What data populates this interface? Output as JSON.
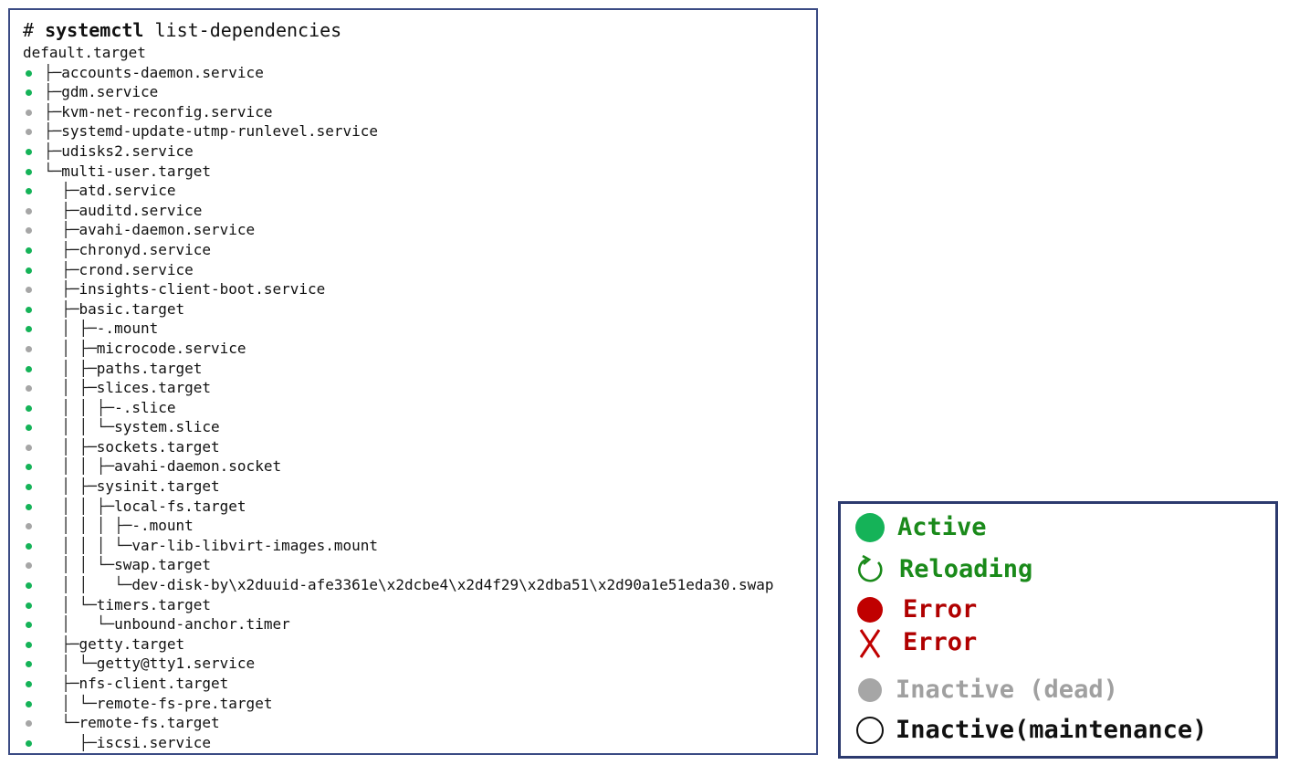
{
  "command": {
    "prompt": "#",
    "program": "systemctl",
    "args": "list-dependencies"
  },
  "root": "default.target",
  "rows": [
    {
      "status": "active",
      "prefix": "├─",
      "depth": 0,
      "name": "accounts-daemon.service"
    },
    {
      "status": "active",
      "prefix": "├─",
      "depth": 0,
      "name": "gdm.service"
    },
    {
      "status": "inactive",
      "prefix": "├─",
      "depth": 0,
      "name": "kvm-net-reconfig.service"
    },
    {
      "status": "inactive",
      "prefix": "├─",
      "depth": 0,
      "name": "systemd-update-utmp-runlevel.service"
    },
    {
      "status": "active",
      "prefix": "├─",
      "depth": 0,
      "name": "udisks2.service"
    },
    {
      "status": "active",
      "prefix": "└─",
      "depth": 0,
      "name": "multi-user.target"
    },
    {
      "status": "active",
      "prefix": "  ├─",
      "depth": 1,
      "name": "atd.service"
    },
    {
      "status": "inactive",
      "prefix": "  ├─",
      "depth": 1,
      "name": "auditd.service"
    },
    {
      "status": "inactive",
      "prefix": "  ├─",
      "depth": 1,
      "name": "avahi-daemon.service"
    },
    {
      "status": "active",
      "prefix": "  ├─",
      "depth": 1,
      "name": "chronyd.service"
    },
    {
      "status": "active",
      "prefix": "  ├─",
      "depth": 1,
      "name": "crond.service"
    },
    {
      "status": "inactive",
      "prefix": "  ├─",
      "depth": 1,
      "name": "insights-client-boot.service"
    },
    {
      "status": "active",
      "prefix": "  ├─",
      "depth": 1,
      "name": "basic.target"
    },
    {
      "status": "active",
      "prefix": "  │ ├─",
      "depth": 2,
      "name": "-.mount"
    },
    {
      "status": "inactive",
      "prefix": "  │ ├─",
      "depth": 2,
      "name": "microcode.service"
    },
    {
      "status": "active",
      "prefix": "  │ ├─",
      "depth": 2,
      "name": "paths.target"
    },
    {
      "status": "inactive",
      "prefix": "  │ ├─",
      "depth": 2,
      "name": "slices.target"
    },
    {
      "status": "active",
      "prefix": "  │ │ ├─",
      "depth": 3,
      "name": "-.slice"
    },
    {
      "status": "active",
      "prefix": "  │ │ └─",
      "depth": 3,
      "name": "system.slice"
    },
    {
      "status": "inactive",
      "prefix": "  │ ├─",
      "depth": 2,
      "name": "sockets.target"
    },
    {
      "status": "active",
      "prefix": "  │ │ ├─",
      "depth": 3,
      "name": "avahi-daemon.socket"
    },
    {
      "status": "active",
      "prefix": "  │ ├─",
      "depth": 2,
      "name": "sysinit.target"
    },
    {
      "status": "active",
      "prefix": "  │ │ ├─",
      "depth": 3,
      "name": "local-fs.target"
    },
    {
      "status": "inactive",
      "prefix": "  │ │ │ ├─",
      "depth": 4,
      "name": "-.mount"
    },
    {
      "status": "active",
      "prefix": "  │ │ │ └─",
      "depth": 4,
      "name": "var-lib-libvirt-images.mount"
    },
    {
      "status": "inactive",
      "prefix": "  │ │ └─",
      "depth": 3,
      "name": "swap.target"
    },
    {
      "status": "active",
      "prefix": "  │ │   └─",
      "depth": 4,
      "name": "dev-disk-by\\x2duuid-afe3361e\\x2dcbe4\\x2d4f29\\x2dba51\\x2d90a1e51eda30.swap"
    },
    {
      "status": "active",
      "prefix": "  │ └─",
      "depth": 2,
      "name": "timers.target"
    },
    {
      "status": "active",
      "prefix": "  │   └─",
      "depth": 3,
      "name": "unbound-anchor.timer"
    },
    {
      "status": "active",
      "prefix": "  ├─",
      "depth": 1,
      "name": "getty.target"
    },
    {
      "status": "active",
      "prefix": "  │ └─",
      "depth": 2,
      "name": "getty@tty1.service"
    },
    {
      "status": "active",
      "prefix": "  ├─",
      "depth": 1,
      "name": "nfs-client.target"
    },
    {
      "status": "active",
      "prefix": "  │ └─",
      "depth": 2,
      "name": "remote-fs-pre.target"
    },
    {
      "status": "inactive",
      "prefix": "  └─",
      "depth": 1,
      "name": "remote-fs.target"
    },
    {
      "status": "active",
      "prefix": "    ├─",
      "depth": 2,
      "name": "iscsi.service"
    }
  ],
  "legend": {
    "items": [
      {
        "icon": "green-dot-icon",
        "label": "Active",
        "color": "#1a8a1a"
      },
      {
        "icon": "reload-icon",
        "label": "Reloading",
        "color": "#1a8a1a"
      },
      {
        "icon": "red-dot-icon",
        "label": "Error",
        "color": "#b00000"
      },
      {
        "icon": "red-x-icon",
        "label": "Error",
        "color": "#b00000"
      },
      {
        "icon": "gray-dot-icon",
        "label": "Inactive (dead)",
        "color": "#a0a0a0"
      },
      {
        "icon": "hollow-dot-icon",
        "label": "Inactive(maintenance)",
        "color": "#111111"
      }
    ]
  },
  "colors": {
    "active": "#15b358",
    "inactive": "#a6a6a6",
    "error": "#c00000",
    "panel_border": "#3b4b84"
  }
}
